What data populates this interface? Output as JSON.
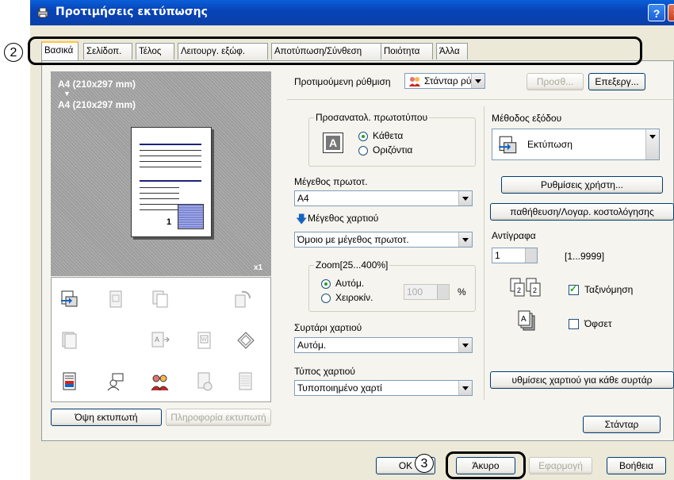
{
  "window": {
    "title": "Προτιμήσεις εκτύπωσης",
    "help_label": "?",
    "close_label": "×"
  },
  "callouts": {
    "tabs": "2",
    "cancel": "3"
  },
  "tabs": [
    {
      "label": "Βασικά",
      "active": true
    },
    {
      "label": "Σελίδοπ.",
      "active": false
    },
    {
      "label": "Τέλος",
      "active": false
    },
    {
      "label": "Λειτουργ. εξώφ.",
      "active": false
    },
    {
      "label": "Αποτύπωση/Σύνθεση",
      "active": false
    },
    {
      "label": "Ποιότητα",
      "active": false
    },
    {
      "label": "Άλλα",
      "active": false
    }
  ],
  "preview": {
    "original_size": "A4 (210x297 mm)",
    "arrow": "▼",
    "paper_size": "A4 (210x297 mm)",
    "page_number": "1",
    "copies_indicator": "x1"
  },
  "icon_grid": [
    "output-method-icon",
    "booklet-icon",
    "copy-icon",
    "rotate-icon",
    "stack-icon",
    "print-position-icon",
    "overlay-icon",
    "paper-insert-icon",
    "color-document-icon",
    "user-auth-icon",
    "account-track-icon",
    "watermark-icon",
    "blank-page-icon"
  ],
  "left_buttons": {
    "printer_view": "Όψη εκτυπωτή",
    "printer_info": "Πληροφορία εκτυπωτή"
  },
  "preferred": {
    "label": "Προτιμούμενη ρύθμιση",
    "value": "Στάνταρ ρύθμισ",
    "add_button": "Προσθ...",
    "edit_button": "Επεξεργ..."
  },
  "orientation": {
    "title": "Προσανατολ. πρωτοτύπου",
    "glyph": "A",
    "portrait": "Κάθετα",
    "landscape": "Οριζόντια",
    "selected": "portrait"
  },
  "original_size": {
    "label": "Μέγεθος πρωτοτ.",
    "value": "A4"
  },
  "paper_size": {
    "label": "Μέγεθος χαρτιού",
    "value": "Όμοιο με μέγεθος πρωτοτ."
  },
  "zoom": {
    "title": "Zoom[25...400%]",
    "auto": "Αυτόμ.",
    "manual": "Χειροκίν.",
    "value": "100",
    "unit": "%",
    "selected": "auto"
  },
  "paper_tray": {
    "label": "Συρτάρι χαρτιού",
    "value": "Αυτόμ."
  },
  "paper_type": {
    "label": "Τύπος χαρτιού",
    "value": "Τυποποιημένο χαρτί"
  },
  "output": {
    "label": "Μέθοδος εξόδου",
    "value": "Εκτύπωση",
    "user_settings_button": "Ρυθμίσεις χρήστη...",
    "store_button": "παθήθευση/Λογαρ. κοστολόγησης"
  },
  "copies": {
    "label": "Αντίγραφα",
    "value": "1",
    "range": "[1...9999]",
    "collate_label": "Ταξινόμηση",
    "collate": true,
    "offset_label": "Όφσετ",
    "offset": false
  },
  "paper_per_tray_button": "υθμίσεις χαρτιού για κάθε συρτάρ",
  "default_button": "Στάνταρ",
  "bottom": {
    "ok": "OK",
    "cancel": "Άκυρο",
    "apply": "Εφαρμογή",
    "help": "Βοήθεια"
  },
  "colors": {
    "title_bar": "#0a4fc8",
    "dialog": "#ece9d8",
    "tab_highlight": "#ffc83c",
    "preview_bg": "#9e9e9e"
  }
}
